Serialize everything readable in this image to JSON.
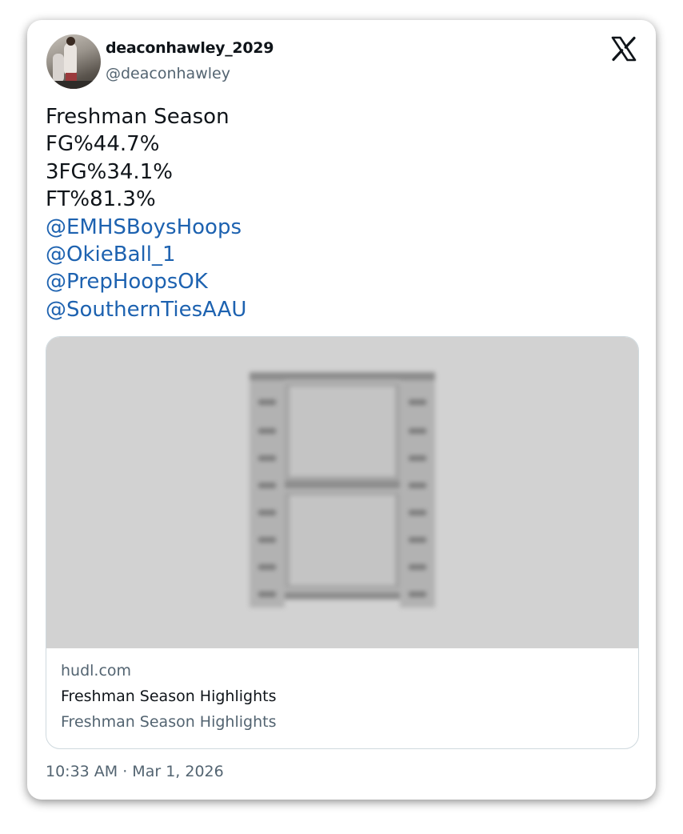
{
  "tweet": {
    "author_name": "deaconhawley_2029",
    "author_handle": "@deaconhawley",
    "lines": [
      "Freshman Season",
      "FG%44.7%",
      "3FG%34.1%",
      "FT%81.3%"
    ],
    "mentions": [
      "@EMHSBoysHoops",
      "@OkieBall_1",
      "@PrepHoopsOK",
      "@SouthernTiesAAU"
    ],
    "timestamp": "10:33 AM · Mar 1, 2026"
  },
  "link_card": {
    "domain": "hudl.com",
    "title": "Freshman Season Highlights",
    "description": "Freshman Season Highlights",
    "media_icon": "film-strip-icon"
  },
  "icons": {
    "brand_logo": "x-logo-icon"
  },
  "colors": {
    "mention": "#1d62b0",
    "secondary_text": "#536471",
    "primary_text": "#0f1419"
  }
}
